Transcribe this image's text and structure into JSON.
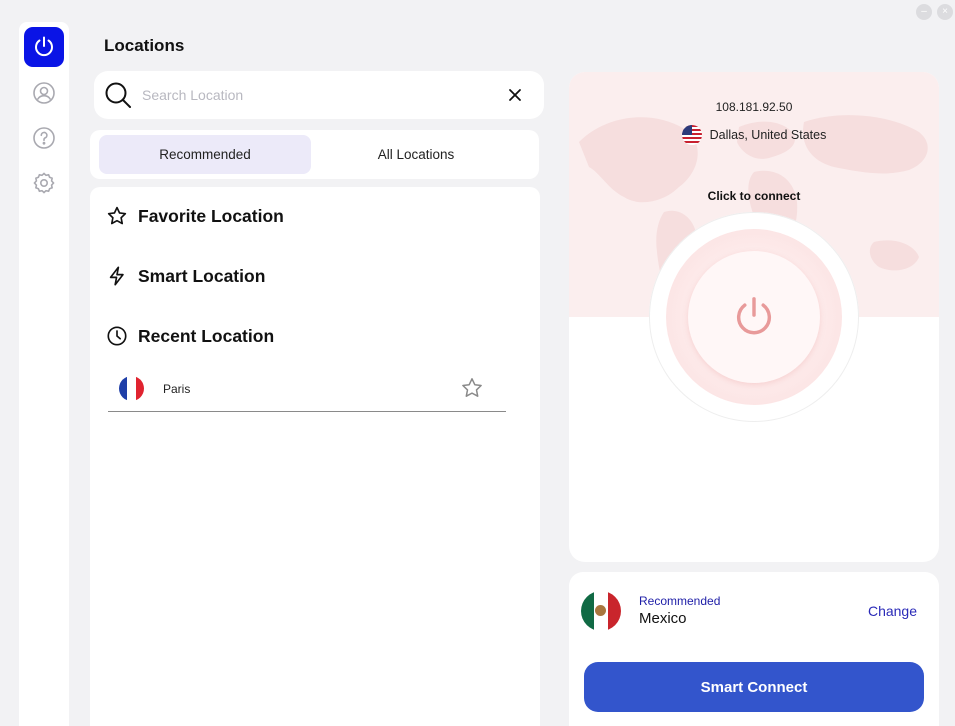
{
  "page": {
    "title": "Locations"
  },
  "sidebar": {
    "items": [
      {
        "icon": "power-icon",
        "active": true
      },
      {
        "icon": "user-icon",
        "active": false
      },
      {
        "icon": "help-icon",
        "active": false
      },
      {
        "icon": "settings-icon",
        "active": false
      }
    ]
  },
  "search": {
    "placeholder": "Search Location",
    "value": ""
  },
  "tabs": [
    {
      "label": "Recommended",
      "active": true
    },
    {
      "label": "All Locations",
      "active": false
    }
  ],
  "sections": {
    "favorite": "Favorite Location",
    "smart": "Smart Location",
    "recent": "Recent Location"
  },
  "recent_locations": [
    {
      "name": "Paris",
      "flag": "france",
      "favorite": false
    }
  ],
  "connection": {
    "ip": "108.181.92.50",
    "location": "Dallas, United States",
    "flag": "united-states",
    "action_label": "Click to connect",
    "status": "disconnected"
  },
  "recommended": {
    "label": "Recommended",
    "country": "Mexico",
    "flag": "mexico",
    "change_label": "Change",
    "connect_button": "Smart Connect"
  },
  "colors": {
    "accent": "#0a14e6",
    "connect_button": "#3355cc",
    "power_icon": "#e89a9a",
    "selected_tab": "#eceaf9"
  }
}
